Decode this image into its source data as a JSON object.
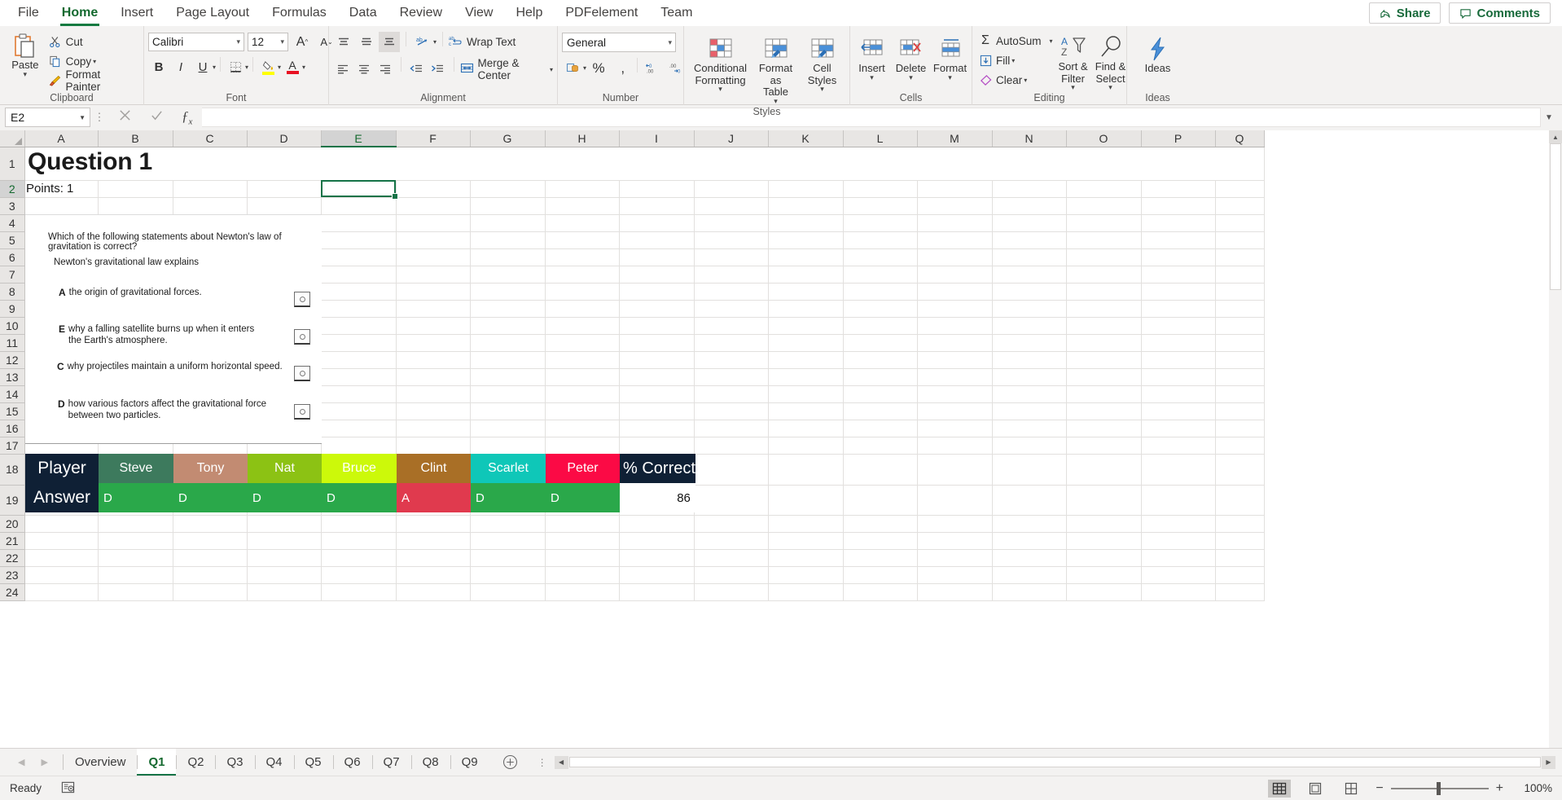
{
  "ribbon": {
    "tabs": [
      {
        "label": "File"
      },
      {
        "label": "Home"
      },
      {
        "label": "Insert"
      },
      {
        "label": "Page Layout"
      },
      {
        "label": "Formulas"
      },
      {
        "label": "Data"
      },
      {
        "label": "Review"
      },
      {
        "label": "View"
      },
      {
        "label": "Help"
      },
      {
        "label": "PDFelement"
      },
      {
        "label": "Team"
      }
    ],
    "share_label": "Share",
    "comments_label": "Comments",
    "clipboard": {
      "group_label": "Clipboard",
      "paste_label": "Paste",
      "cut_label": "Cut",
      "copy_label": "Copy",
      "format_painter_label": "Format Painter"
    },
    "font": {
      "group_label": "Font",
      "font_name": "Calibri",
      "font_size": "12",
      "grow_label": "A",
      "shrink_label": "A",
      "bold_label": "B",
      "italic_label": "I",
      "underline_label": "U"
    },
    "alignment": {
      "group_label": "Alignment",
      "wrap_text_label": "Wrap Text",
      "merge_center_label": "Merge & Center"
    },
    "number": {
      "group_label": "Number",
      "format_value": "General",
      "percent_label": "%",
      "comma_label": " ,"
    },
    "styles": {
      "group_label": "Styles",
      "conditional_formatting_label": "Conditional\nFormatting",
      "format_as_table_label": "Format as\nTable",
      "cell_styles_label": "Cell\nStyles"
    },
    "cells": {
      "group_label": "Cells",
      "insert_label": "Insert",
      "delete_label": "Delete",
      "format_label": "Format"
    },
    "editing": {
      "group_label": "Editing",
      "autosum_label": "AutoSum",
      "fill_label": "Fill",
      "clear_label": "Clear",
      "sort_filter_label": "Sort &\nFilter",
      "find_select_label": "Find &\nSelect"
    },
    "ideas": {
      "group_label": "Ideas",
      "ideas_label": "Ideas"
    }
  },
  "formula_bar": {
    "name_box": "E2",
    "formula_value": "",
    "cancel_icon": "close-icon",
    "confirm_icon": "check-icon",
    "function_icon": "fx-icon"
  },
  "grid": {
    "columns": [
      "A",
      "B",
      "C",
      "D",
      "E",
      "F",
      "G",
      "H",
      "I",
      "J",
      "K",
      "L",
      "M",
      "N",
      "O",
      "P",
      "Q"
    ],
    "selected_column": "E",
    "selected_row": 2,
    "rows": [
      1,
      2,
      3,
      4,
      5,
      6,
      7,
      8,
      9,
      10,
      11,
      12,
      13,
      14,
      15,
      16,
      17,
      18,
      19,
      20,
      21,
      22,
      23,
      24
    ]
  },
  "sheet_content": {
    "title": "Question 1",
    "points": "Points: 1",
    "question_stem": "Which of the following statements about Newton's law of gravitation is correct?",
    "question_sub": "Newton's gravitational law explains",
    "options": [
      {
        "letter": "A",
        "text": "the origin of gravitational forces."
      },
      {
        "letter": "E",
        "text": "why a falling satellite burns up when it enters the Earth's atmosphere."
      },
      {
        "letter": "C",
        "text": "why projectiles maintain a uniform horizontal speed."
      },
      {
        "letter": "D",
        "text": "how various factors affect the gravitational force between two particles."
      }
    ]
  },
  "player_table": {
    "header_label": "Player",
    "answer_label": "Answer",
    "percent_header": "% Correct",
    "percent_value": "86",
    "header_bg": "#0f2035",
    "correct_bg": "#2aa84a",
    "wrong_bg": "#e03a4e",
    "players": [
      {
        "name": "Steve",
        "color": "#3d7a5d",
        "answer": "D",
        "correct": true
      },
      {
        "name": "Tony",
        "color": "#c28b72",
        "answer": "D",
        "correct": true
      },
      {
        "name": "Nat",
        "color": "#8cc214",
        "answer": "D",
        "correct": true
      },
      {
        "name": "Bruce",
        "color": "#ccf90a",
        "answer": "D",
        "correct": true
      },
      {
        "name": "Clint",
        "color": "#a96f26",
        "answer": "A",
        "correct": false
      },
      {
        "name": "Scarlet",
        "color": "#0fc7b8",
        "answer": "D",
        "correct": true
      },
      {
        "name": "Peter",
        "color": "#fb0a45",
        "answer": "D",
        "correct": true
      }
    ]
  },
  "sheet_tabs": {
    "items": [
      "Overview",
      "Q1",
      "Q2",
      "Q3",
      "Q4",
      "Q5",
      "Q6",
      "Q7",
      "Q8",
      "Q9"
    ],
    "active": "Q1",
    "add_sheet_icon": "plus-circle-icon"
  },
  "status_bar": {
    "status_text": "Ready",
    "accessibility_icon": "accessibility-check-icon",
    "view_normal_icon": "normal-view-icon",
    "view_pagelayout_icon": "page-layout-view-icon",
    "view_pagebreak_icon": "page-break-view-icon",
    "zoom_out_label": "−",
    "zoom_in_label": "+",
    "zoom_level": "100%"
  }
}
